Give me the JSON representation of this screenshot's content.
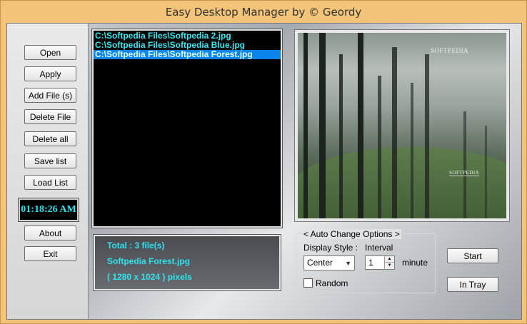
{
  "window": {
    "title": "Easy Desktop Manager by © Geordy"
  },
  "sidebar": {
    "buttons": {
      "open": "Open",
      "apply": "Apply",
      "add_file": "Add File (s)",
      "delete_file": "Delete File",
      "delete_all": "Delete all",
      "save_list": "Save list",
      "load_list": "Load List",
      "about": "About",
      "exit": "Exit"
    },
    "clock": "01:18:26 AM"
  },
  "file_list": {
    "items": [
      "C:\\Softpedia Files\\Softpedia 2.jpg",
      "C:\\Softpedia Files\\Softpedia Blue.jpg",
      "C:\\Softpedia Files\\Softpedia Forest.jpg"
    ],
    "selected_index": 2
  },
  "info": {
    "total": "Total : 3 file(s)",
    "filename": "Softpedia Forest.jpg",
    "dimensions": "( 1280 x 1024 ) pixels"
  },
  "preview": {
    "watermark_top": "SOFTPEDIA",
    "watermark_bottom": "SOFTPEDIA"
  },
  "auto_change": {
    "title": "< Auto Change Options >",
    "display_style_label": "Display Style :",
    "display_style_value": "Center",
    "interval_label": "Interval",
    "interval_value": "1",
    "interval_unit": "minute",
    "random_label": "Random"
  },
  "actions": {
    "start": "Start",
    "in_tray": "In Tray"
  },
  "colors": {
    "list_text": "#3fe8f2",
    "list_selected_bg": "#0a84e8",
    "clock_text": "#28e6f0",
    "frame": "#f3c378"
  }
}
